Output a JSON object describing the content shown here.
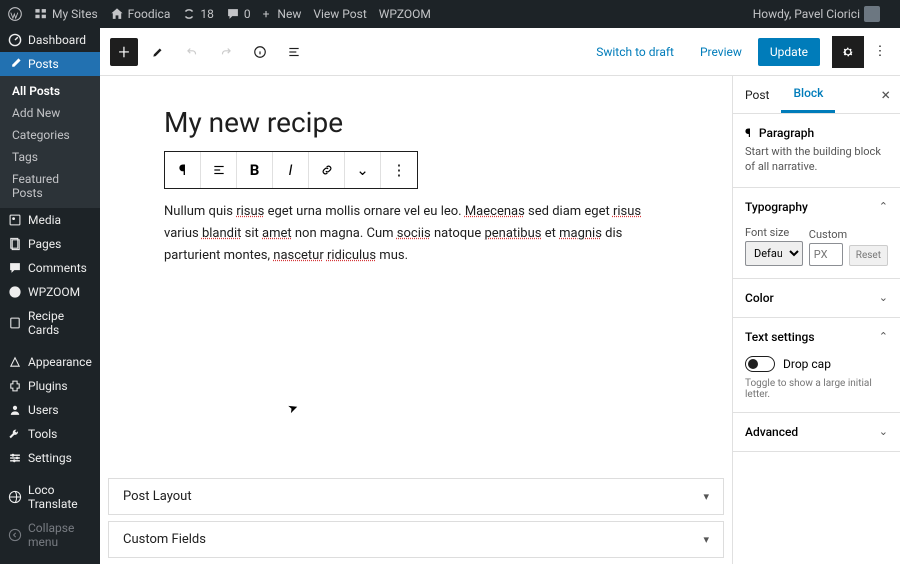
{
  "adminbar": {
    "mysites": "My Sites",
    "site": "Foodica",
    "updates": "18",
    "comments": "0",
    "new": "New",
    "view": "View Post",
    "wpzoom": "WPZOOM",
    "howdy": "Howdy, Pavel Ciorici"
  },
  "sidebar": {
    "dashboard": "Dashboard",
    "posts": "Posts",
    "sub": {
      "all": "All Posts",
      "add": "Add New",
      "cats": "Categories",
      "tags": "Tags",
      "feat": "Featured Posts"
    },
    "media": "Media",
    "pages": "Pages",
    "comments": "Comments",
    "wpzoom": "WPZOOM",
    "recipe": "Recipe Cards",
    "appearance": "Appearance",
    "plugins": "Plugins",
    "users": "Users",
    "tools": "Tools",
    "settings": "Settings",
    "loco": "Loco Translate",
    "collapse": "Collapse menu"
  },
  "topbar": {
    "switch": "Switch to draft",
    "preview": "Preview",
    "update": "Update"
  },
  "editor": {
    "title": "My new recipe",
    "p1a": "Nullum quis ",
    "p1b": "risus",
    "p1c": " eget urna mollis ornare vel eu leo. ",
    "p1d": "Maecenas",
    "p1e": " sed diam eget ",
    "p1f": "risus",
    "p1g": " varius ",
    "p1h": "blandit",
    "p1i": " sit ",
    "p1j": "amet",
    "p1k": " non magna. Cum ",
    "p1l": "sociis",
    "p1m": " natoque ",
    "p1n": "penatibus",
    "p1o": " et ",
    "p1p": "magnis",
    "p1q": " dis parturient montes, ",
    "p1r": "nascetur",
    "p1s": " ",
    "p1t": "ridiculus",
    "p1u": " mus."
  },
  "meta": {
    "layout": "Post Layout",
    "custom": "Custom Fields"
  },
  "inspector": {
    "post_tab": "Post",
    "block_tab": "Block",
    "block_title": "Paragraph",
    "block_desc": "Start with the building block of all narrative.",
    "typography": "Typography",
    "fontsize": "Font size",
    "fontsize_val": "Default",
    "custom": "Custom",
    "px": "PX",
    "reset": "Reset",
    "color": "Color",
    "text": "Text settings",
    "dropcap": "Drop cap",
    "dropcap_help": "Toggle to show a large initial letter.",
    "advanced": "Advanced"
  }
}
